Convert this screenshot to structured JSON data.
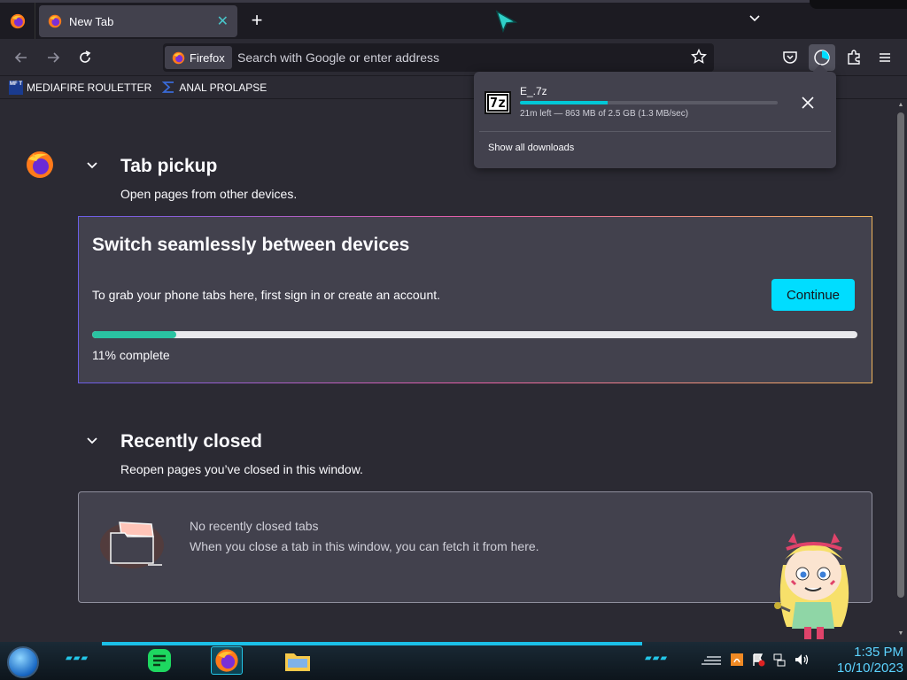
{
  "browser": {
    "tab_title": "New Tab",
    "identity_label": "Firefox",
    "url_placeholder": "Search with Google or enter address"
  },
  "bookmarks": [
    {
      "label": "MEDIAFIRE ROULETTER",
      "icon": "mediafire-icon",
      "icon_text": "MF T"
    },
    {
      "label": "ANAL PROLAPSE",
      "icon": "sigma-icon"
    }
  ],
  "tab_pickup": {
    "title": "Tab pickup",
    "subtitle": "Open pages from other devices.",
    "card_title": "Switch seamlessly between devices",
    "card_message": "To grab your phone tabs here, first sign in or create an account.",
    "continue_label": "Continue",
    "progress_fraction": 0.11,
    "progress_label": "11% complete"
  },
  "recently_closed": {
    "title": "Recently closed",
    "subtitle": "Reopen pages you’ve closed in this window.",
    "empty_title": "No recently closed tabs",
    "empty_message": "When you close a tab in this window, you can fetch it from here."
  },
  "download": {
    "icon_text": "7z",
    "filename": "E_.7z",
    "progress_fraction": 0.34,
    "status": "21m left — 863 MB of 2.5 GB (1.3 MB/sec)",
    "show_all_label": "Show all downloads"
  },
  "taskbar": {
    "time": "1:35 PM",
    "date": "10/10/2023"
  },
  "colors": {
    "accent": "#00ddff",
    "progress_fill": "#2ac3a2",
    "page_bg": "#2b2a33",
    "card_bg": "#42414d"
  }
}
